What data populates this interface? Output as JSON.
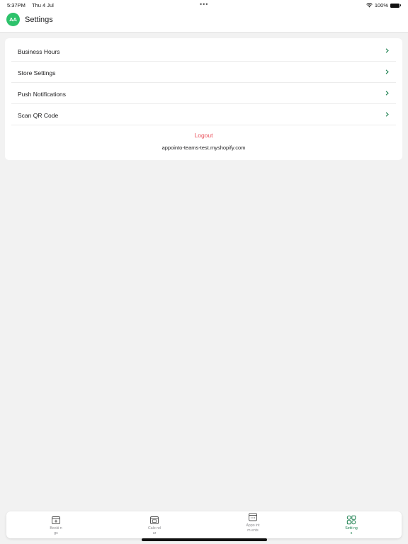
{
  "status_bar": {
    "time": "5:37PM",
    "date": "Thu 4 Jul",
    "battery": "100%"
  },
  "header": {
    "avatar_initials": "AA",
    "title": "Settings"
  },
  "menu": {
    "items": [
      {
        "label": "Business Hours"
      },
      {
        "label": "Store Settings"
      },
      {
        "label": "Push Notifications"
      },
      {
        "label": "Scan QR Code"
      }
    ],
    "logout_label": "Logout",
    "shop_domain": "appointo-teams-test.myshopify.com"
  },
  "tab_bar": {
    "tabs": [
      {
        "label": "Booki ngs",
        "icon": "calendar-plus-icon"
      },
      {
        "label": "Cale ndar",
        "icon": "calendar-date-icon"
      },
      {
        "label": "Appo intm ents",
        "icon": "calendar-dots-icon"
      },
      {
        "label": "Setti ngs",
        "icon": "grid-settings-icon",
        "active": true
      }
    ]
  },
  "colors": {
    "accent": "#1a7f4e",
    "avatar": "#2dc26b",
    "logout": "#e9505a",
    "background": "#f2f2f2"
  }
}
